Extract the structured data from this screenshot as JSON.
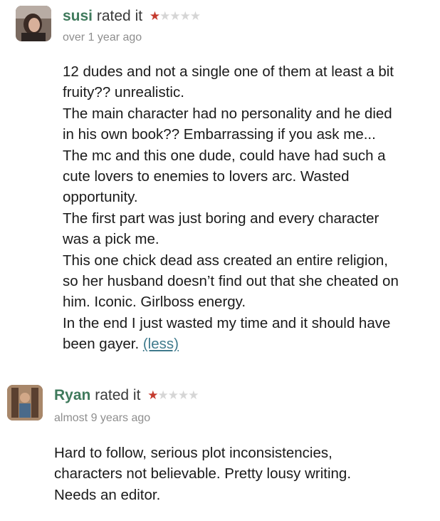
{
  "colors": {
    "username": "#3f7a5c",
    "star_on": "#c43a2e",
    "star_off": "#d6d6d6",
    "timestamp": "#8e8e8e",
    "link": "#3f7a8c"
  },
  "reviews": [
    {
      "username": "susi",
      "rated_label": "rated it",
      "rating": 1,
      "max_rating": 5,
      "timestamp": "over 1 year ago",
      "body_lines": [
        "12 dudes and not a single one of them at least a bit",
        "fruity?? unrealistic.",
        "The main character had no personality and he died",
        "in his own book?? Embarrassing if you ask me...",
        "The mc and this one dude, could have had such a",
        "cute lovers to enemies to lovers arc. Wasted",
        "opportunity.",
        "The first part was just boring and every character",
        "was a pick me.",
        "This one chick dead ass created an entire religion,",
        "so her husband doesn’t find out that she cheated on",
        "him. Iconic. Girlboss energy.",
        "In the end I just wasted my time and it should have",
        "been gayer."
      ],
      "less_link": "(less)"
    },
    {
      "username": "Ryan",
      "rated_label": "rated it",
      "rating": 1,
      "max_rating": 5,
      "timestamp": "almost 9 years ago",
      "body_lines": [
        "Hard to follow, serious plot inconsistencies,",
        "characters not believable. Pretty lousy writing.",
        "Needs an editor."
      ]
    }
  ]
}
